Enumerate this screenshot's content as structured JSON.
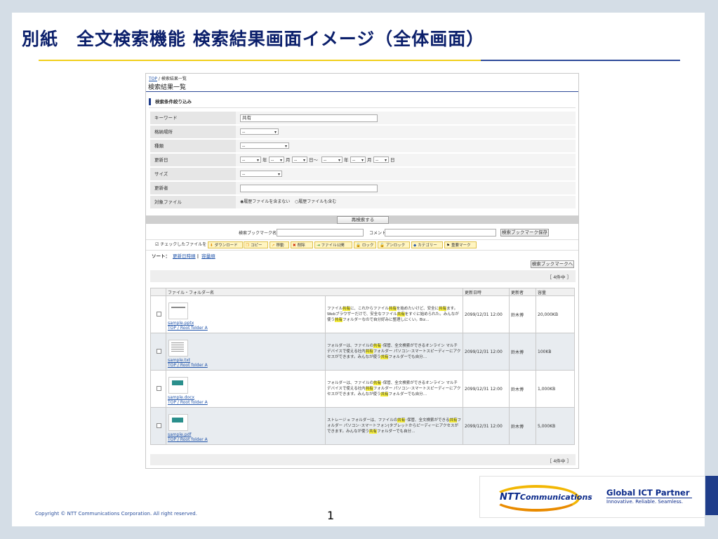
{
  "slide": {
    "title": "別紙　全文検索機能 検索結果画面イメージ（全体画面）",
    "copyright": "Copyright © NTT Communications Corporation. All right reserved.",
    "page_number": "1",
    "logo": {
      "ntt": "NTT",
      "comm": "Communications",
      "tagline": "Global ICT Partner",
      "sub": "Innovative. Reliable. Seamless."
    }
  },
  "screen": {
    "breadcrumb_top": "TOP",
    "breadcrumb_sep": " / ",
    "breadcrumb_current": "検索結果一覧",
    "page_title": "検索結果一覧",
    "section_title": "検索条件絞り込み",
    "filters": {
      "keyword_label": "キーワード",
      "keyword_value": "共有",
      "location_label": "格納場所",
      "location_value": "--",
      "kind_label": "種類",
      "kind_value": "--",
      "updated_label": "更新日",
      "dash": "--",
      "year": "年",
      "month": "月",
      "day_from": "日～",
      "day": "日",
      "size_label": "サイズ",
      "size_value": "--",
      "updater_label": "更新者",
      "target_label": "対象ファイル",
      "radio_exclude": "◉履歴ファイルを含まない",
      "radio_include": "○履歴ファイルも含む"
    },
    "research_button": "再検索する",
    "bookmark": {
      "name_label": "検索ブックマーク名",
      "comment_label": "コメント",
      "save_button": "検索ブックマーク保存",
      "goto_button": "検索ブックマークへ"
    },
    "actions": {
      "checked_label": "☑ チェックしたファイルを｜",
      "buttons": [
        {
          "icon": "⬇",
          "label": "ダウンロード",
          "color": "#e08a00"
        },
        {
          "icon": "❐",
          "label": "コピー",
          "color": "#e08a00"
        },
        {
          "icon": "➚",
          "label": "移動",
          "color": "#e08a00"
        },
        {
          "icon": "✖",
          "label": "削除",
          "color": "#cc2200"
        },
        {
          "icon": "⇥",
          "label": "ファイル公開",
          "color": "#1a7f1a"
        },
        {
          "icon": "🔒",
          "label": "ロック",
          "color": "#c08a00"
        },
        {
          "icon": "🔓",
          "label": "アンロック",
          "color": "#c08a00"
        },
        {
          "icon": "◆",
          "label": "カテゴリー",
          "color": "#2255aa"
        },
        {
          "icon": "⚑",
          "label": "重要マーク",
          "color": "#222"
        }
      ]
    },
    "sort": {
      "label": "ソート：",
      "by_date": "更新日時順",
      "sep": "|",
      "by_size": "容量順"
    },
    "count_text": "［ 4件中 ］",
    "table": {
      "headers": [
        "",
        "ファイル・フォルダー名",
        "更新日時",
        "更新者",
        "容量"
      ],
      "rows": [
        {
          "file": "sample.pptx",
          "path": "TOP / Root folder A",
          "thumb": "slide",
          "snippet_html": "ファイル<mark>共有</mark>に、これからファイル<mark>共有</mark>を始めたいけど、安全に<mark>共有</mark>ます。Webブラウザーだけで、安全なファイル<mark>共有</mark>をすぐに始められた。みんなが使う<mark>共有</mark>フォルダーなので自分好みに整理しにくい。Biz…",
          "date": "2099/12/31 12:00",
          "user": "鈴木博",
          "size": "20,000KB"
        },
        {
          "file": "sample.txt",
          "path": "TOP / Root folder A",
          "thumb": "doc",
          "snippet_html": "フォルダーは、ファイルの<mark>共有</mark>･保管、全文検索ができるオンライン マルチデバイスで使える社内<mark>共有</mark>フォルダー パソコン･スマートスピーディーにアクセスができます。みんなが使う<mark>共有</mark>フォルダーでも自分…",
          "date": "2099/12/31 12:00",
          "user": "鈴木博",
          "size": "100KB"
        },
        {
          "file": "sample.docx",
          "path": "TOP / Root folder A",
          "thumb": "img",
          "snippet_html": "フォルダーは、ファイルの<mark>共有</mark>･保管、全文検索ができるオンライン マルチデバイスで使える社内<mark>共有</mark>フォルダー パソコン･スマートスピーディーにアクセスができます。みんなが使う<mark>共有</mark>フォルダーでも自分…",
          "date": "2099/12/31 12:00",
          "user": "鈴木博",
          "size": "1,000KB"
        },
        {
          "file": "sample.pdf",
          "path": "TOP / Root folder A",
          "thumb": "img",
          "snippet_html": "ストレージ e フォルダーは、ファイルの<mark>共有</mark>･保管、全文検索ができる<mark>共有</mark>フォルダー パソコン･スマートフォン|タブレットからピーディーにアクセスができます。みんなが使う<mark>共有</mark>フォルダーでも自分…",
          "date": "2099/12/31 12:00",
          "user": "鈴木博",
          "size": "5,000KB"
        }
      ]
    },
    "bottom_count": "［ 4件中 ］"
  }
}
